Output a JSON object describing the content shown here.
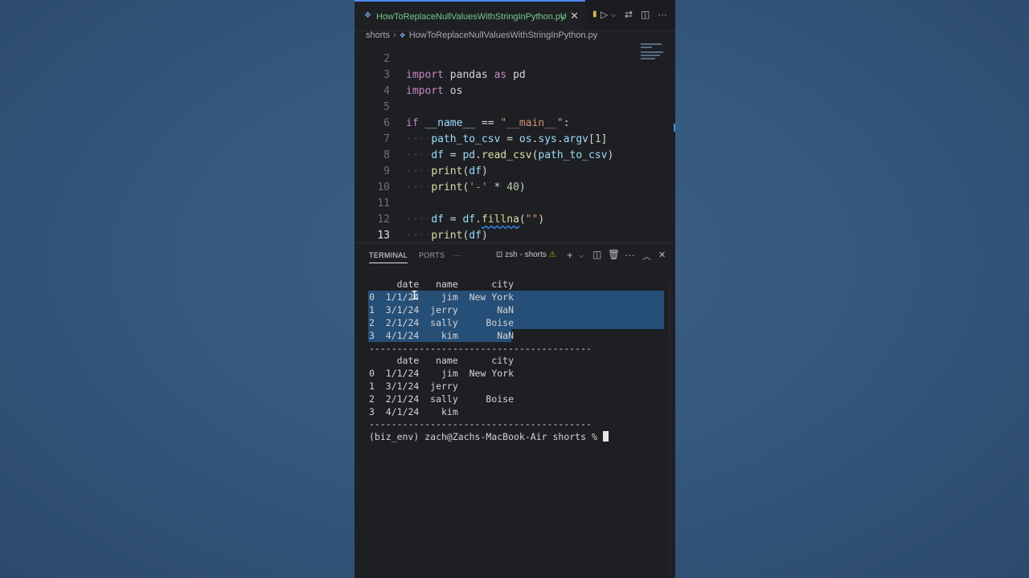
{
  "tab": {
    "title": "HowToReplaceNullValuesWithStringInPython.py",
    "status": "U",
    "close": "✕"
  },
  "breadcrumbs": {
    "folder": "shorts",
    "file": "HowToReplaceNullValuesWithStringInPython.py"
  },
  "editor": {
    "active_line": 13,
    "lines": [
      {
        "n": "2",
        "text": "import pandas as pd"
      },
      {
        "n": "3",
        "text": "import os"
      },
      {
        "n": "4",
        "text": ""
      },
      {
        "n": "5",
        "text": "if __name__ == \"__main__\":"
      },
      {
        "n": "6",
        "text": "path_to_csv = os.sys.argv[1]"
      },
      {
        "n": "7",
        "text": "df = pd.read_csv(path_to_csv)"
      },
      {
        "n": "8",
        "text": "print(df)"
      },
      {
        "n": "9",
        "text": "print('-' * 40)"
      },
      {
        "n": "10",
        "text": ""
      },
      {
        "n": "11",
        "text": "df = df.fillna(\"\")"
      },
      {
        "n": "12",
        "text": "print(df)"
      },
      {
        "n": "13",
        "text": "print('-' * 40)"
      }
    ]
  },
  "terminal_panel": {
    "tabs": [
      "TERMINAL",
      "PORTS"
    ],
    "more": "···",
    "terminal_name": "zsh - shorts"
  },
  "terminal": {
    "lines": [
      "     date   name      city",
      "0  1/1/24    jim  New York",
      "1  3/1/24  jerry       NaN",
      "2  2/1/24  sally     Boise",
      "3  4/1/24    kim       NaN",
      "----------------------------------------",
      "     date   name      city",
      "0  1/1/24    jim  New York",
      "1  3/1/24  jerry",
      "2  2/1/24  sally     Boise",
      "3  4/1/24    kim",
      "----------------------------------------"
    ],
    "prompt": "(biz_env) zach@Zachs-MacBook-Air shorts % "
  },
  "colors": {
    "background": "#35587e",
    "panel": "#1e1f22",
    "selection": "#264f78",
    "untracked_file": "#73c991",
    "accent": "#3794ff"
  }
}
